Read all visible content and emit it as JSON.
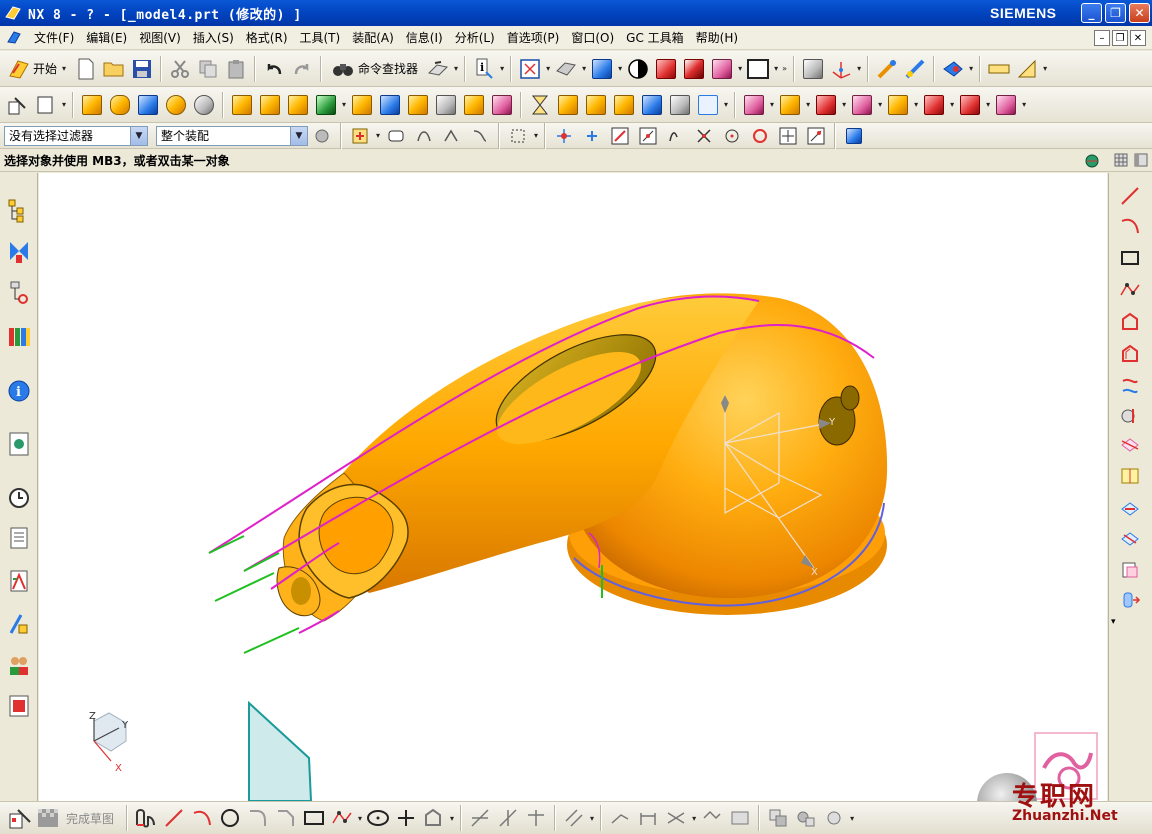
{
  "window": {
    "title": "NX 8 - ? - [_model4.prt  (修改的) ]",
    "brand": "SIEMENS"
  },
  "menu": {
    "items": [
      "文件(F)",
      "编辑(E)",
      "视图(V)",
      "插入(S)",
      "格式(R)",
      "工具(T)",
      "装配(A)",
      "信息(I)",
      "分析(L)",
      "首选项(P)",
      "窗口(O)",
      "GC 工具箱",
      "帮助(H)"
    ]
  },
  "toolbar": {
    "start_label": "开始",
    "command_finder_label": "命令查找器"
  },
  "selection_bar": {
    "filter_value": "没有选择过滤器",
    "scope_value": "整个装配"
  },
  "status": {
    "prompt": "选择对象并使用 MB3，或者双击某一对象"
  },
  "sketch_bar": {
    "finish_sketch_label": "完成草图"
  },
  "viewport": {
    "triad_x": "X",
    "triad_y": "Y",
    "triad_z": "Z",
    "csys_x": "X",
    "csys_y": "Y",
    "model_color": "#ffa500",
    "edge_color": "#e020c8",
    "line_color": "#20c020"
  },
  "watermark": {
    "site_cn": "专职网",
    "site_url": "Zhuanzhi.Net"
  }
}
